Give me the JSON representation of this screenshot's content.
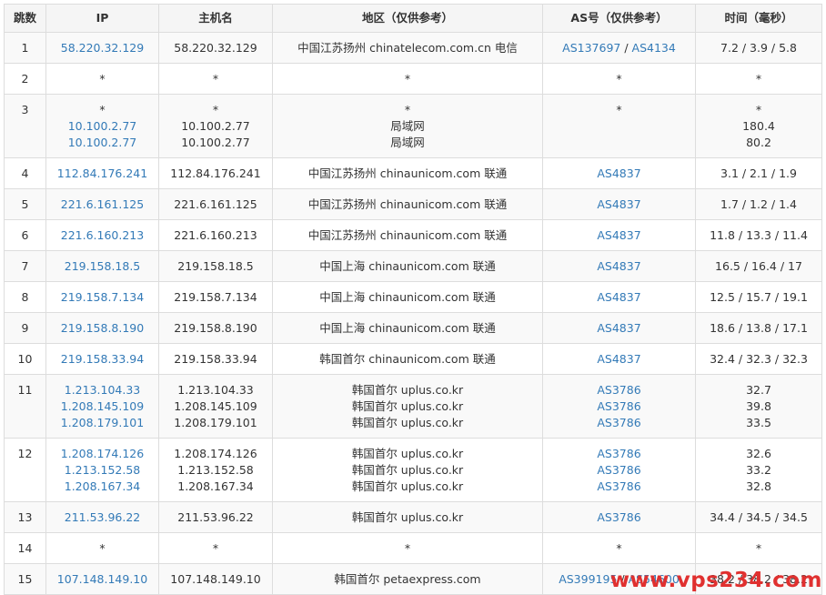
{
  "table": {
    "headers": [
      "跳数",
      "IP",
      "主机名",
      "地区（仅供参考）",
      "AS号（仅供参考）",
      "时间（毫秒）"
    ],
    "rows": [
      {
        "hop": "1",
        "ips": [
          "58.220.32.129"
        ],
        "hosts": [
          "58.220.32.129"
        ],
        "regions": [
          "中国江苏扬州 chinatelecom.com.cn 电信"
        ],
        "as": [
          [
            "AS137697",
            "AS4134"
          ]
        ],
        "times": [
          "7.2 / 3.9 / 5.8"
        ]
      },
      {
        "hop": "2",
        "ips": [
          "*"
        ],
        "hosts": [
          "*"
        ],
        "regions": [
          "*"
        ],
        "as": [
          [
            "*"
          ]
        ],
        "times": [
          "*"
        ]
      },
      {
        "hop": "3",
        "ips": [
          "*",
          "10.100.2.77",
          "10.100.2.77"
        ],
        "hosts": [
          "*",
          "10.100.2.77",
          "10.100.2.77"
        ],
        "regions": [
          "*",
          "局域网",
          "局域网"
        ],
        "as": [
          [
            "*"
          ]
        ],
        "times": [
          "*",
          "180.4",
          "80.2"
        ]
      },
      {
        "hop": "4",
        "ips": [
          "112.84.176.241"
        ],
        "hosts": [
          "112.84.176.241"
        ],
        "regions": [
          "中国江苏扬州 chinaunicom.com 联通"
        ],
        "as": [
          [
            "AS4837"
          ]
        ],
        "times": [
          "3.1 / 2.1 / 1.9"
        ]
      },
      {
        "hop": "5",
        "ips": [
          "221.6.161.125"
        ],
        "hosts": [
          "221.6.161.125"
        ],
        "regions": [
          "中国江苏扬州 chinaunicom.com 联通"
        ],
        "as": [
          [
            "AS4837"
          ]
        ],
        "times": [
          "1.7 / 1.2 / 1.4"
        ]
      },
      {
        "hop": "6",
        "ips": [
          "221.6.160.213"
        ],
        "hosts": [
          "221.6.160.213"
        ],
        "regions": [
          "中国江苏扬州 chinaunicom.com 联通"
        ],
        "as": [
          [
            "AS4837"
          ]
        ],
        "times": [
          "11.8 / 13.3 / 11.4"
        ]
      },
      {
        "hop": "7",
        "ips": [
          "219.158.18.5"
        ],
        "hosts": [
          "219.158.18.5"
        ],
        "regions": [
          "中国上海 chinaunicom.com 联通"
        ],
        "as": [
          [
            "AS4837"
          ]
        ],
        "times": [
          "16.5 / 16.4 / 17"
        ]
      },
      {
        "hop": "8",
        "ips": [
          "219.158.7.134"
        ],
        "hosts": [
          "219.158.7.134"
        ],
        "regions": [
          "中国上海 chinaunicom.com 联通"
        ],
        "as": [
          [
            "AS4837"
          ]
        ],
        "times": [
          "12.5 / 15.7 / 19.1"
        ]
      },
      {
        "hop": "9",
        "ips": [
          "219.158.8.190"
        ],
        "hosts": [
          "219.158.8.190"
        ],
        "regions": [
          "中国上海 chinaunicom.com 联通"
        ],
        "as": [
          [
            "AS4837"
          ]
        ],
        "times": [
          "18.6 / 13.8 / 17.1"
        ]
      },
      {
        "hop": "10",
        "ips": [
          "219.158.33.94"
        ],
        "hosts": [
          "219.158.33.94"
        ],
        "regions": [
          "韩国首尔 chinaunicom.com 联通"
        ],
        "as": [
          [
            "AS4837"
          ]
        ],
        "times": [
          "32.4 / 32.3 / 32.3"
        ]
      },
      {
        "hop": "11",
        "ips": [
          "1.213.104.33",
          "1.208.145.109",
          "1.208.179.101"
        ],
        "hosts": [
          "1.213.104.33",
          "1.208.145.109",
          "1.208.179.101"
        ],
        "regions": [
          "韩国首尔 uplus.co.kr",
          "韩国首尔 uplus.co.kr",
          "韩国首尔 uplus.co.kr"
        ],
        "as": [
          [
            "AS3786"
          ],
          [
            "AS3786"
          ],
          [
            "AS3786"
          ]
        ],
        "times": [
          "32.7",
          "39.8",
          "33.5"
        ]
      },
      {
        "hop": "12",
        "ips": [
          "1.208.174.126",
          "1.213.152.58",
          "1.208.167.34"
        ],
        "hosts": [
          "1.208.174.126",
          "1.213.152.58",
          "1.208.167.34"
        ],
        "regions": [
          "韩国首尔 uplus.co.kr",
          "韩国首尔 uplus.co.kr",
          "韩国首尔 uplus.co.kr"
        ],
        "as": [
          [
            "AS3786"
          ],
          [
            "AS3786"
          ],
          [
            "AS3786"
          ]
        ],
        "times": [
          "32.6",
          "33.2",
          "32.8"
        ]
      },
      {
        "hop": "13",
        "ips": [
          "211.53.96.22"
        ],
        "hosts": [
          "211.53.96.22"
        ],
        "regions": [
          "韩国首尔 uplus.co.kr"
        ],
        "as": [
          [
            "AS3786"
          ]
        ],
        "times": [
          "34.4 / 34.5 / 34.5"
        ]
      },
      {
        "hop": "14",
        "ips": [
          "*"
        ],
        "hosts": [
          "*"
        ],
        "regions": [
          "*"
        ],
        "as": [
          [
            "*"
          ]
        ],
        "times": [
          "*"
        ]
      },
      {
        "hop": "15",
        "ips": [
          "107.148.149.10"
        ],
        "hosts": [
          "107.148.149.10"
        ],
        "regions": [
          "韩国首尔 petaexpress.com"
        ],
        "as": [
          [
            "AS399195",
            "AS54600"
          ]
        ],
        "times": [
          "38.2 / 38.2 / 38.2"
        ]
      }
    ]
  },
  "watermark": "www.vps234.com",
  "colors": {
    "link": "#337ab7",
    "text": "#333333",
    "border": "#dddddd",
    "stripe": "#f9f9f9",
    "watermark": "#e0302f"
  }
}
